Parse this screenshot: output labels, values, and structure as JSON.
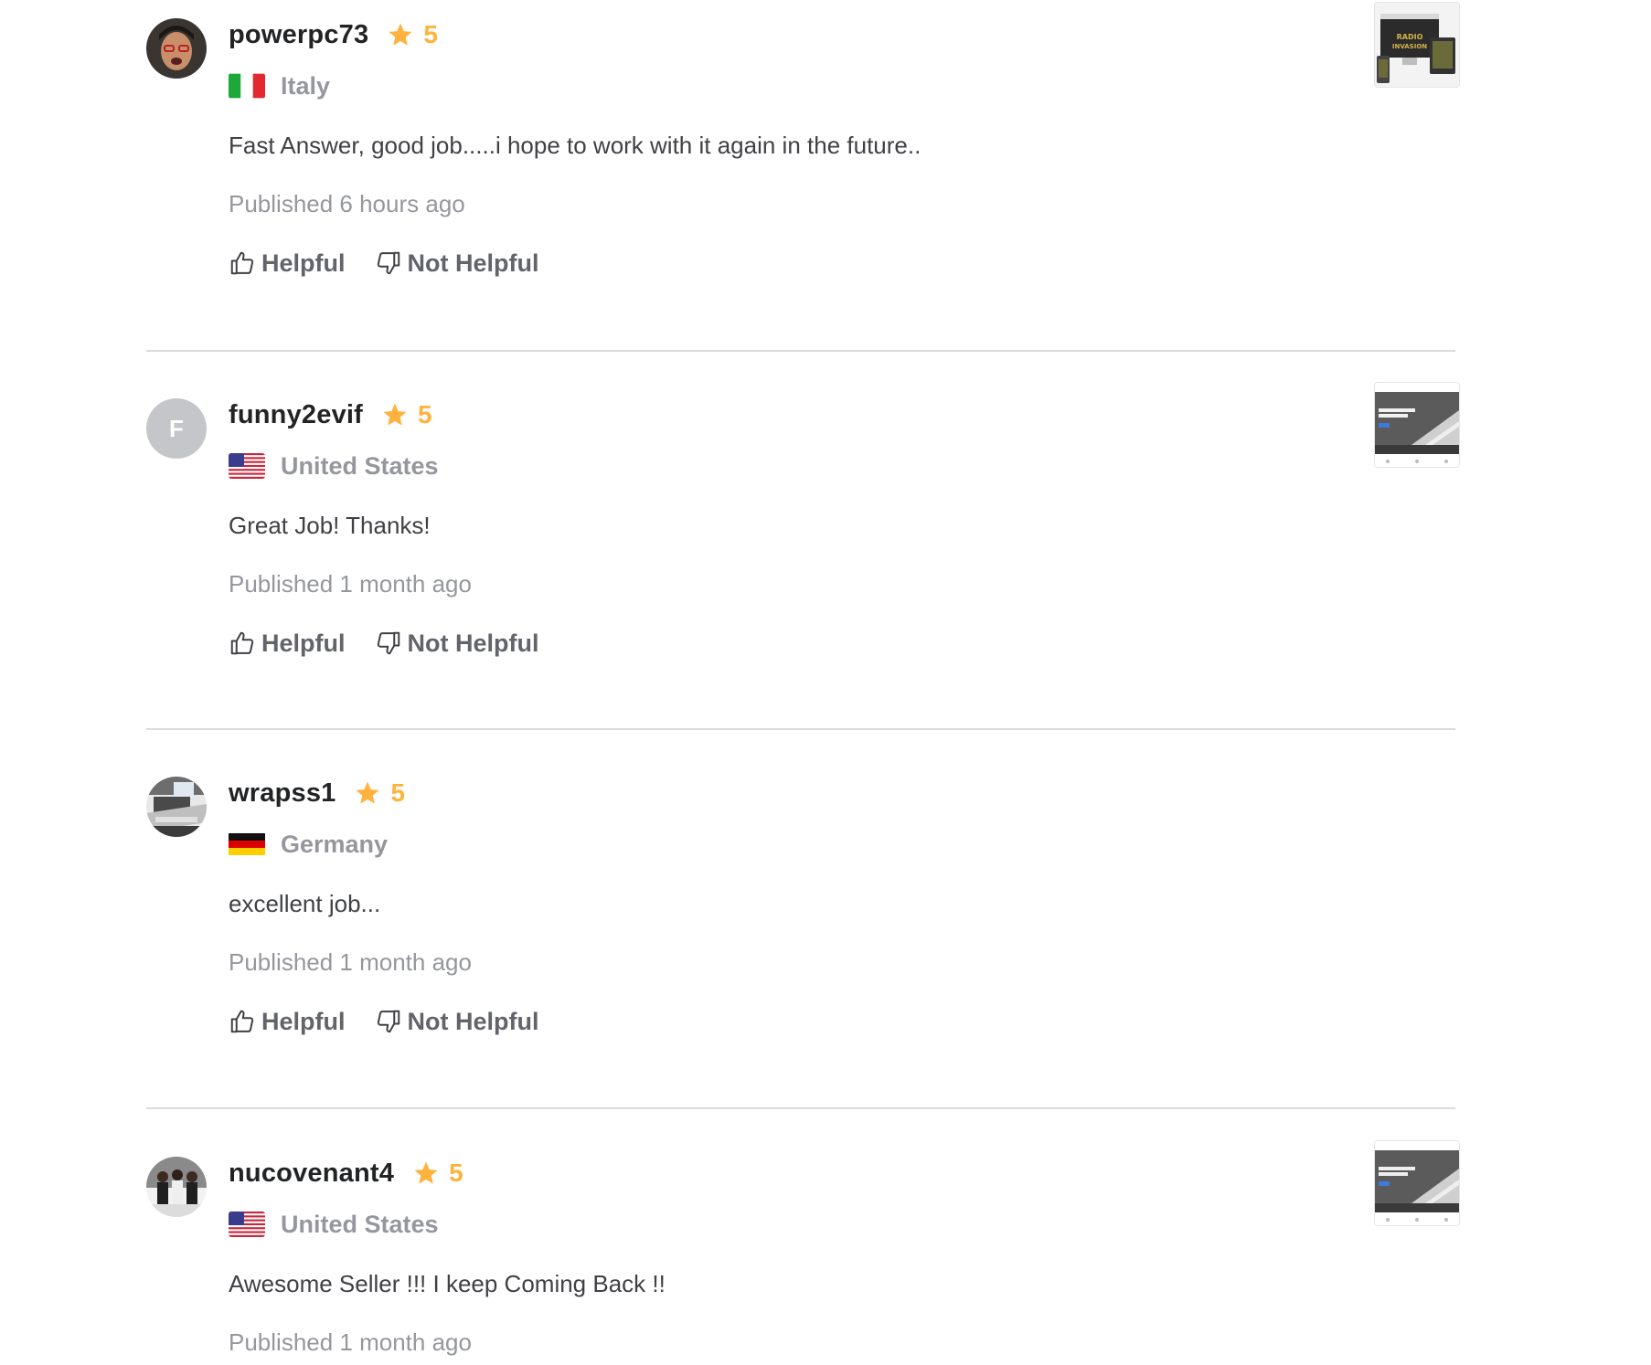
{
  "reviews": [
    {
      "username": "powerpc73",
      "rating": "5",
      "country": "Italy",
      "flag": "italy-flag",
      "text": "Fast Answer, good job.....i hope to work with it again in the future..",
      "published": "Published 6 hours ago",
      "helpful_label": "Helpful",
      "not_helpful_label": "Not Helpful",
      "avatar": "photo"
    },
    {
      "username": "funny2evif",
      "rating": "5",
      "country": "United States",
      "flag": "us-flag",
      "text": "Great Job! Thanks!",
      "published": "Published 1 month ago",
      "helpful_label": "Helpful",
      "not_helpful_label": "Not Helpful",
      "avatar_letter": "F"
    },
    {
      "username": "wrapss1",
      "rating": "5",
      "country": "Germany",
      "flag": "germany-flag",
      "text": "excellent job...",
      "published": "Published 1 month ago",
      "helpful_label": "Helpful",
      "not_helpful_label": "Not Helpful",
      "avatar": "photo"
    },
    {
      "username": "nucovenant4",
      "rating": "5",
      "country": "United States",
      "flag": "us-flag",
      "text": "Awesome Seller !!! I keep Coming Back !!",
      "published": "Published 1 month ago",
      "avatar": "photo"
    }
  ],
  "colors": {
    "star": "#ffb33e",
    "username": "#222325",
    "muted": "#95979d",
    "body_text": "#404145",
    "divider": "#dadbdd"
  },
  "icons": {
    "star": "star-icon",
    "helpful": "thumbs-up-icon",
    "not_helpful": "thumbs-down-icon"
  }
}
